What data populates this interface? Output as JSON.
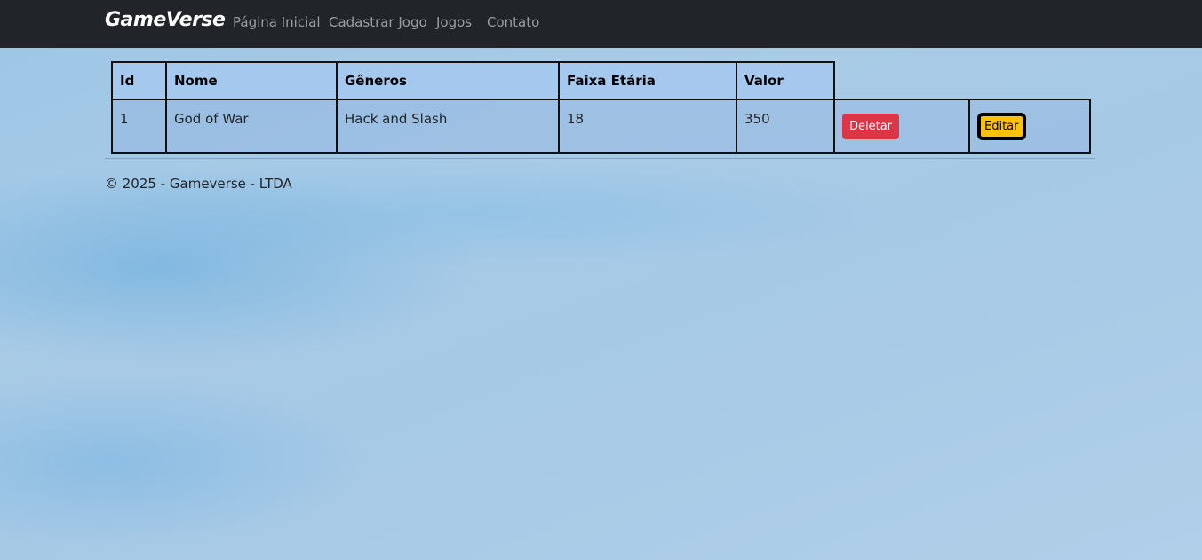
{
  "navbar": {
    "brand": "GameVerse",
    "links": [
      "Página Inicial",
      "Cadastrar Jogo",
      "Jogos",
      "Contato"
    ]
  },
  "table": {
    "headers": [
      "Id",
      "Nome",
      "Gêneros",
      "Faixa Etária",
      "Valor"
    ],
    "rows": [
      {
        "id": "1",
        "nome": "God of War",
        "generos": "Hack and Slash",
        "faixa_etaria": "18",
        "valor": "350",
        "delete_label": "Deletar",
        "edit_label": "Editar"
      }
    ]
  },
  "footer": {
    "text": "© 2025 - Gameverse - LTDA"
  },
  "colors": {
    "navbar_bg": "#212529",
    "delete_button": "#dc3545",
    "edit_button": "#ffc107"
  }
}
